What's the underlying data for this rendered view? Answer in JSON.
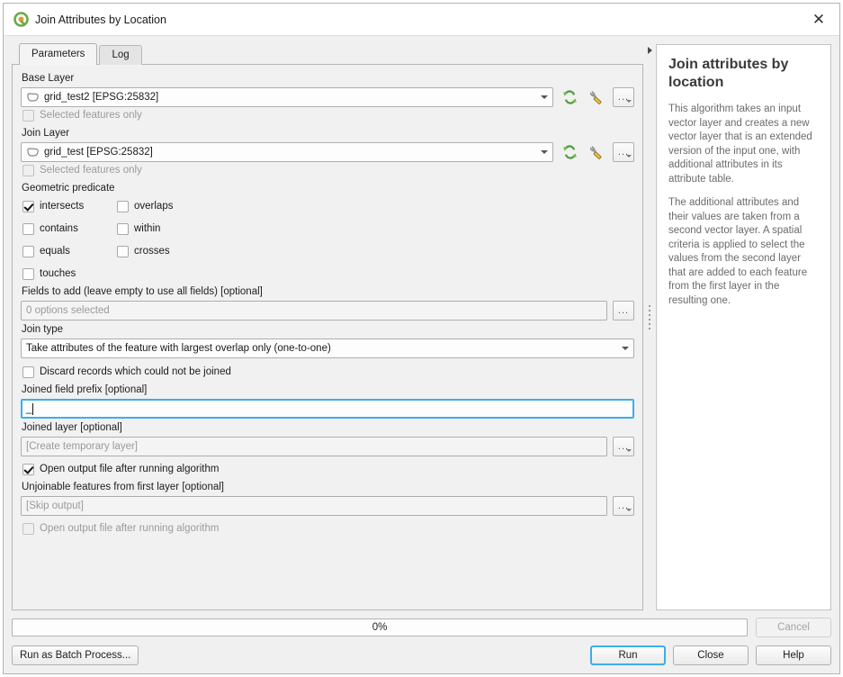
{
  "window": {
    "title": "Join Attributes by Location",
    "logo_icon": "qgis-logo-icon",
    "close_icon": "close-icon"
  },
  "tabs": [
    {
      "label": "Parameters",
      "active": true
    },
    {
      "label": "Log",
      "active": false
    }
  ],
  "parameters": {
    "base_layer": {
      "label": "Base Layer",
      "value": "grid_test2 [EPSG:25832]",
      "layer_icon": "polygon-layer-icon",
      "refresh_icon": "refresh-icon",
      "wrench_icon": "wrench-icon",
      "browse_label": "...",
      "selected_features_only": {
        "label": "Selected features only",
        "checked": false,
        "disabled": true
      }
    },
    "join_layer": {
      "label": "Join Layer",
      "value": "grid_test [EPSG:25832]",
      "layer_icon": "polygon-layer-icon",
      "refresh_icon": "refresh-icon",
      "wrench_icon": "wrench-icon",
      "browse_label": "...",
      "selected_features_only": {
        "label": "Selected features only",
        "checked": false,
        "disabled": true
      }
    },
    "geometric_predicate": {
      "label": "Geometric predicate",
      "options": [
        {
          "label": "intersects",
          "checked": true
        },
        {
          "label": "overlaps",
          "checked": false
        },
        {
          "label": "contains",
          "checked": false
        },
        {
          "label": "within",
          "checked": false
        },
        {
          "label": "equals",
          "checked": false
        },
        {
          "label": "crosses",
          "checked": false
        },
        {
          "label": "touches",
          "checked": false
        }
      ]
    },
    "fields_to_add": {
      "label": "Fields to add (leave empty to use all fields) [optional]",
      "value": "0 options selected",
      "browse_label": "..."
    },
    "join_type": {
      "label": "Join type",
      "value": "Take attributes of the feature with largest overlap only (one-to-one)"
    },
    "discard_records": {
      "label": "Discard records which could not be joined",
      "checked": false
    },
    "joined_field_prefix": {
      "label": "Joined field prefix [optional]",
      "value": "_",
      "focused": true
    },
    "joined_layer": {
      "label": "Joined layer [optional]",
      "placeholder": "[Create temporary layer]",
      "browse_label": "..."
    },
    "open_output_joined": {
      "label": "Open output file after running algorithm",
      "checked": true,
      "disabled": false
    },
    "unjoinable_features": {
      "label": "Unjoinable features from first layer [optional]",
      "placeholder": "[Skip output]",
      "browse_label": "..."
    },
    "open_output_unjoinable": {
      "label": "Open output file after running algorithm",
      "checked": false,
      "disabled": true
    }
  },
  "help": {
    "title": "Join attributes by location",
    "paragraphs": [
      "This algorithm takes an input vector layer and creates a new vector layer that is an extended version of the input one, with additional attributes in its attribute table.",
      "The additional attributes and their values are taken from a second vector layer. A spatial criteria is applied to select the values from the second layer that are added to each feature from the first layer in the resulting one."
    ]
  },
  "footer": {
    "progress_text": "0%",
    "progress_value": 0,
    "cancel_label": "Cancel",
    "batch_label": "Run as Batch Process...",
    "run_label": "Run",
    "close_label": "Close",
    "help_label": "Help"
  },
  "colors": {
    "accent": "#3daee9",
    "window_bg": "#f0f0f0",
    "panel_bg": "#f1f1f1",
    "qgis_green": "#6aa84f"
  }
}
